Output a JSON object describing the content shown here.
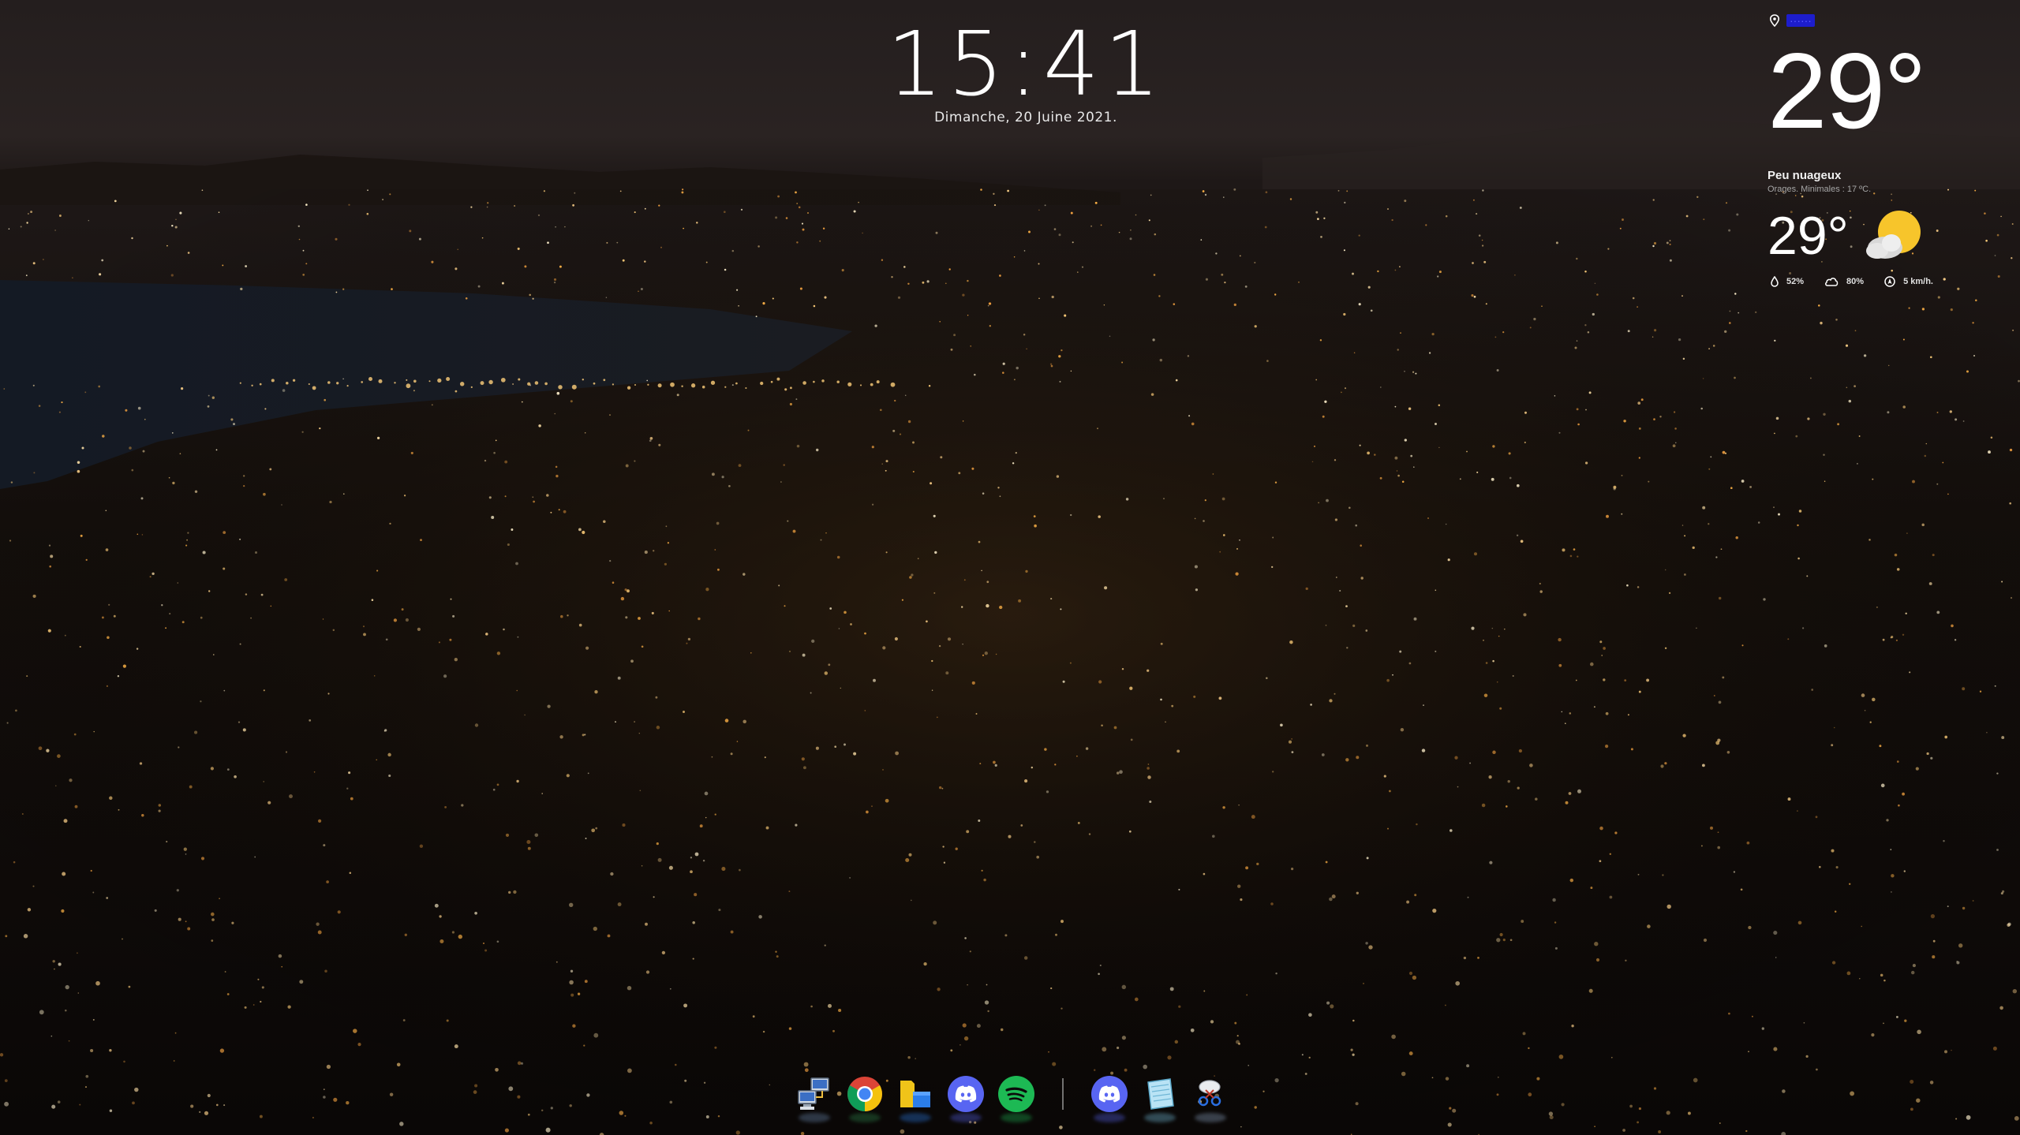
{
  "clock": {
    "time": "15:41",
    "date": "Dimanche, 20 Juine 2021."
  },
  "weather": {
    "location_icon": "location-pin-icon",
    "location_name": "······",
    "temperature_large": "29°",
    "condition": "Peu nuageux",
    "forecast_note": "Orages. Minimales : 17 ºC.",
    "temperature_current": "29°",
    "condition_icon": "partly-cloudy-sun-icon",
    "humidity": "52%",
    "cloud_cover": "80%",
    "wind": "5 km/h."
  },
  "dock": {
    "items": [
      {
        "name": "network-computers-icon",
        "tooltip": ""
      },
      {
        "name": "chrome-icon",
        "tooltip": ""
      },
      {
        "name": "file-explorer-icon",
        "tooltip": ""
      },
      {
        "name": "discord-icon",
        "tooltip": ""
      },
      {
        "name": "spotify-icon",
        "tooltip": ""
      },
      {
        "name": "discord-icon",
        "tooltip": ""
      },
      {
        "name": "notepad-icon",
        "tooltip": ""
      },
      {
        "name": "snipping-tool-icon",
        "tooltip": ""
      }
    ]
  },
  "colors": {
    "discord": "#5865F2",
    "spotify": "#1DB954",
    "sun": "#F7C52B",
    "location_highlight": "#1d1dcc"
  }
}
